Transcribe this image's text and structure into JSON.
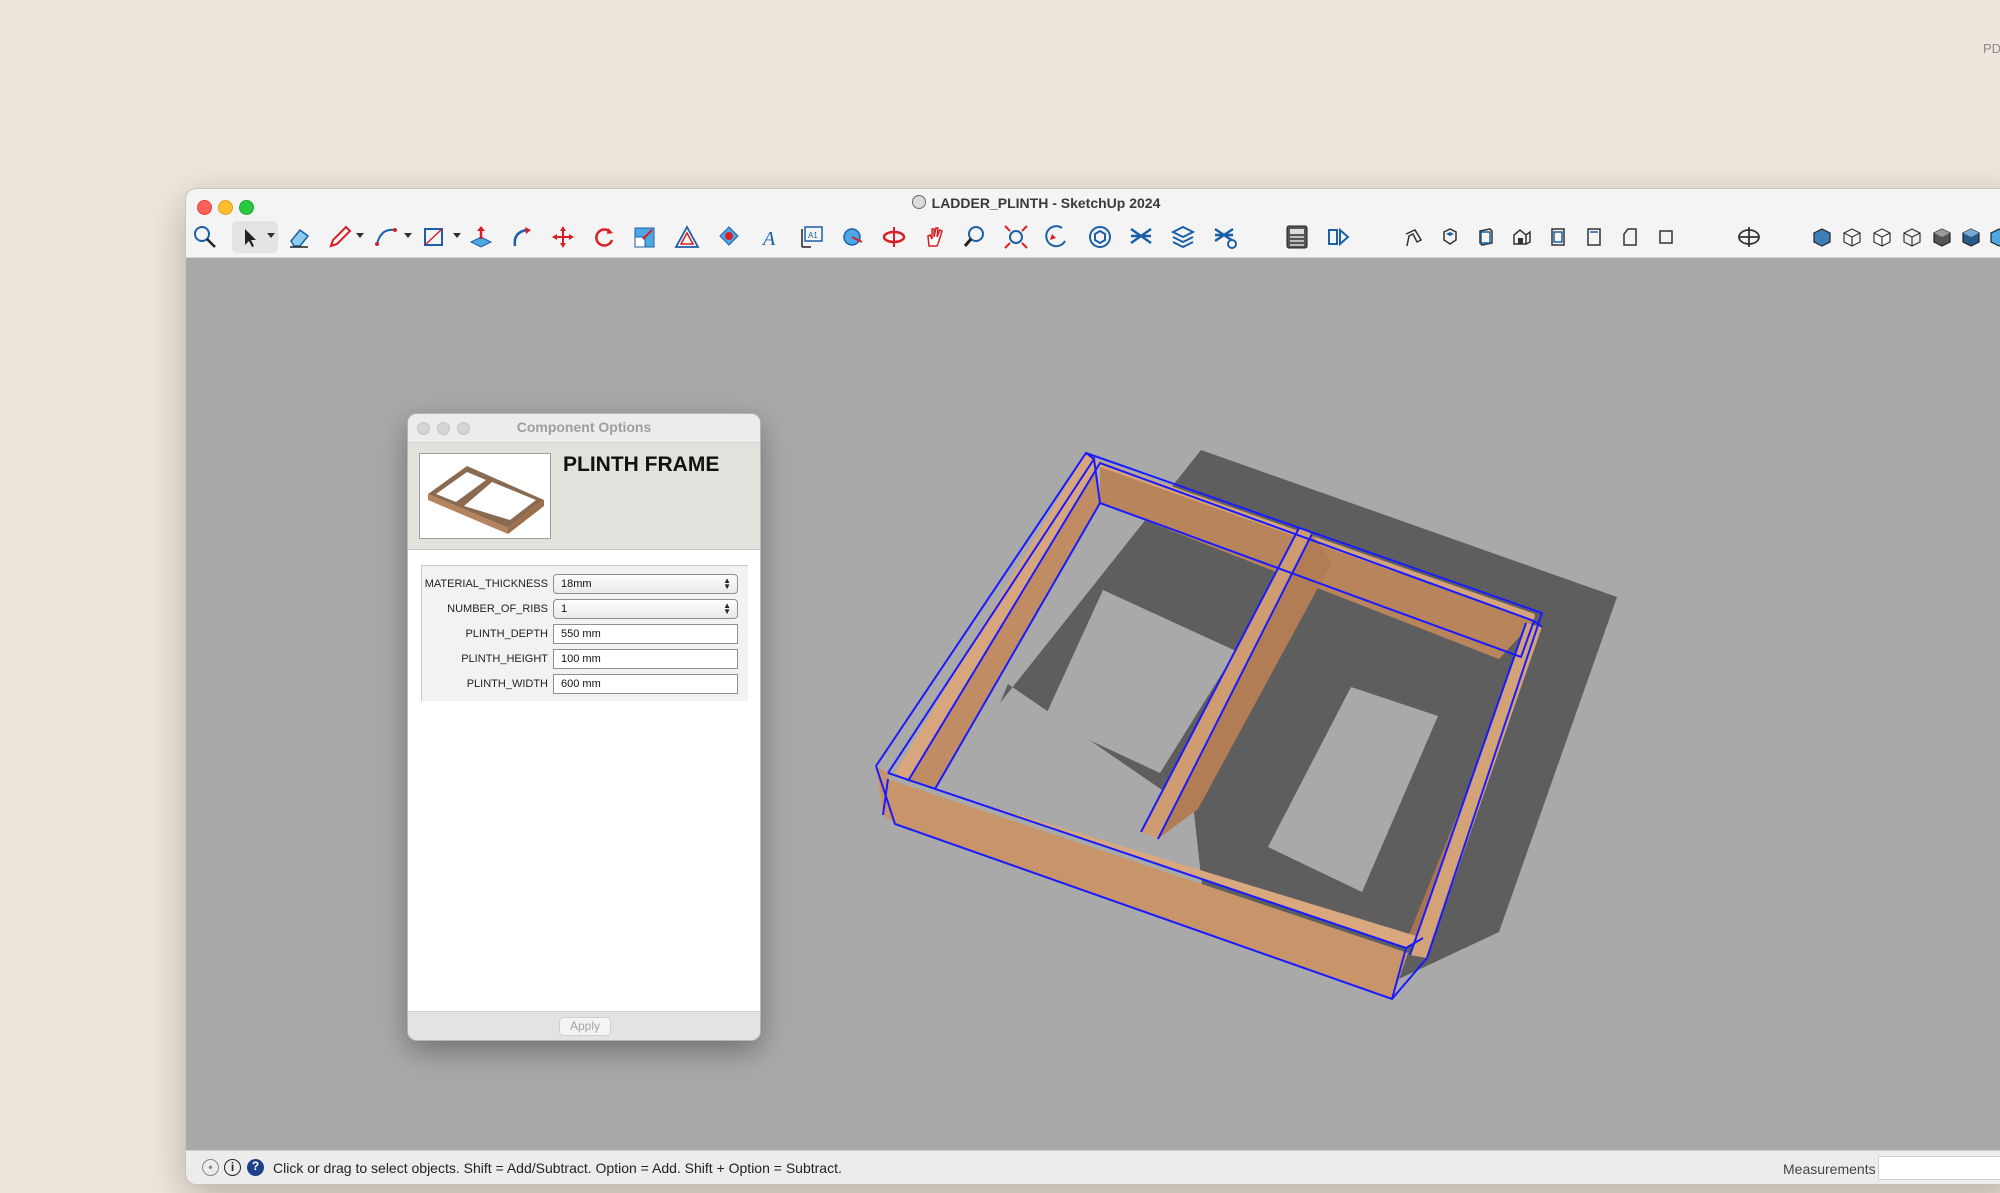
{
  "desktop": {
    "corner_text": "PD"
  },
  "window": {
    "title": "LADDER_PLINTH - SketchUp 2024",
    "toolbar": {
      "tools": [
        {
          "name": "search-icon"
        },
        {
          "name": "select-arrow-icon"
        },
        {
          "name": "eraser-icon"
        },
        {
          "name": "pencil-line-icon"
        },
        {
          "name": "arc-icon"
        },
        {
          "name": "rectangle-icon"
        },
        {
          "name": "push-pull-icon"
        },
        {
          "name": "follow-me-icon"
        },
        {
          "name": "move-icon"
        },
        {
          "name": "rotate-icon"
        },
        {
          "name": "scale-icon"
        },
        {
          "name": "offset-icon"
        },
        {
          "name": "paint-bucket-icon"
        },
        {
          "name": "text-icon"
        },
        {
          "name": "dimension-icon"
        },
        {
          "name": "tape-measure-icon"
        },
        {
          "name": "orbit-icon"
        },
        {
          "name": "pan-icon"
        },
        {
          "name": "zoom-icon"
        },
        {
          "name": "zoom-extents-icon"
        },
        {
          "name": "previous-view-icon"
        },
        {
          "name": "components-icon"
        },
        {
          "name": "extension-warehouse-icon"
        },
        {
          "name": "layers-icon"
        },
        {
          "name": "settings-layers-icon"
        },
        {
          "name": "calculator-icon"
        },
        {
          "name": "scenes-icon"
        },
        {
          "name": "iso-view-icon"
        },
        {
          "name": "top-view-icon"
        },
        {
          "name": "front-view-icon"
        },
        {
          "name": "right-view-icon"
        },
        {
          "name": "back-view-icon"
        },
        {
          "name": "left-view-icon"
        },
        {
          "name": "bottom-view-icon"
        },
        {
          "name": "perspective-icon"
        },
        {
          "name": "xray-style-icon"
        },
        {
          "name": "wireframe-style-icon"
        },
        {
          "name": "hidden-line-style-icon"
        },
        {
          "name": "shaded-style-icon"
        },
        {
          "name": "shaded-textures-style-icon"
        },
        {
          "name": "monochrome-style-icon"
        },
        {
          "name": "extra-style-icon"
        }
      ]
    },
    "dialog": {
      "title": "Component Options",
      "component_name": "PLINTH FRAME",
      "params": [
        {
          "label": "MATERIAL_THICKNESS",
          "value": "18mm",
          "type": "select"
        },
        {
          "label": "NUMBER_OF_RIBS",
          "value": "1",
          "type": "select"
        },
        {
          "label": "PLINTH_DEPTH",
          "value": "550 mm",
          "type": "text"
        },
        {
          "label": "PLINTH_HEIGHT",
          "value": "100 mm",
          "type": "text"
        },
        {
          "label": "PLINTH_WIDTH",
          "value": "600 mm",
          "type": "text"
        }
      ],
      "apply_label": "Apply"
    },
    "statusbar": {
      "hint": "Click or drag to select objects. Shift = Add/Subtract. Option = Add. Shift + Option = Subtract.",
      "measurements_label": "Measurements",
      "measurements_value": ""
    },
    "mini_toolbar": {
      "buttons": [
        {
          "name": "ocl-cutlist-icon"
        },
        {
          "name": "material-icon"
        },
        {
          "name": "axes-export-icon"
        },
        {
          "name": "export-icon"
        }
      ]
    },
    "colors": {
      "viewport_bg": "#a9a9a9",
      "wood": "#c8956a",
      "selection": "#1a1aff",
      "shadow": "#5e5e5e"
    }
  }
}
